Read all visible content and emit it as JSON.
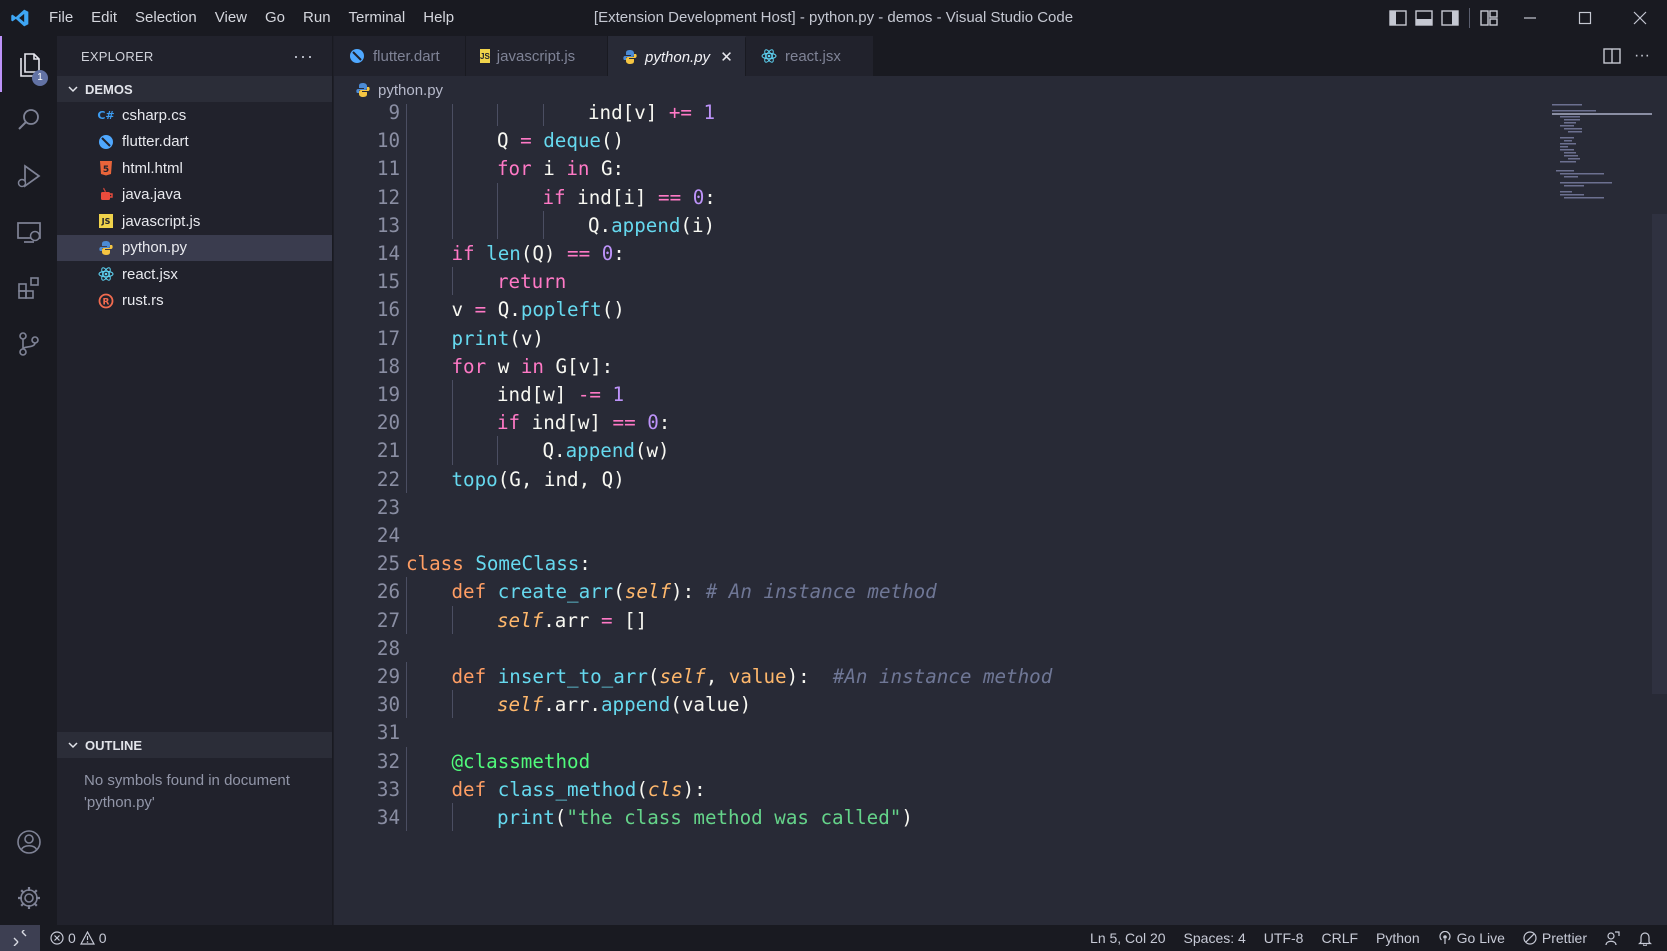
{
  "titlebar": {
    "title": "[Extension Development Host] - python.py - demos - Visual Studio Code",
    "menu": [
      "File",
      "Edit",
      "Selection",
      "View",
      "Go",
      "Run",
      "Terminal",
      "Help"
    ]
  },
  "activity": {
    "explorer_badge": "1"
  },
  "sidebar": {
    "header": "EXPLORER",
    "folder": "DEMOS",
    "files": [
      {
        "name": "csharp.cs",
        "icon": "csharp-icon",
        "glyph": "C#",
        "color": "#3c9bf0"
      },
      {
        "name": "flutter.dart",
        "icon": "dart-icon",
        "glyph": "",
        "color": "#4fa8ff"
      },
      {
        "name": "html.html",
        "icon": "html-icon",
        "glyph": "5",
        "color": "#e8643a"
      },
      {
        "name": "java.java",
        "icon": "java-icon",
        "glyph": "",
        "color": "#ea4b3c"
      },
      {
        "name": "javascript.js",
        "icon": "javascript-icon",
        "glyph": "JS",
        "color": "#f0d34b"
      },
      {
        "name": "python.py",
        "icon": "python-icon",
        "glyph": "",
        "color": "#f5c542"
      },
      {
        "name": "react.jsx",
        "icon": "react-icon",
        "glyph": "",
        "color": "#5ed3f3"
      },
      {
        "name": "rust.rs",
        "icon": "rust-icon",
        "glyph": "R",
        "color": "#f26b4f"
      }
    ],
    "outline_title": "OUTLINE",
    "outline_message": "No symbols found in document 'python.py'"
  },
  "tabs": [
    {
      "label": "flutter.dart",
      "icon": "dart-icon"
    },
    {
      "label": "javascript.js",
      "icon": "javascript-icon"
    },
    {
      "label": "python.py",
      "icon": "python-icon"
    },
    {
      "label": "react.jsx",
      "icon": "react-icon"
    }
  ],
  "breadcrumb": "python.py",
  "statusbar": {
    "errors": "0",
    "warnings": "0",
    "position": "Ln 5, Col 20",
    "spaces": "Spaces: 4",
    "encoding": "UTF-8",
    "eol": "CRLF",
    "language": "Python",
    "golive": "Go Live",
    "prettier": "Prettier"
  },
  "colors": {
    "accent": "#bd93f9",
    "editor_bg": "#282a36",
    "sidebar_bg": "#21222c"
  },
  "code": [
    {
      "ln": "9",
      "indent": 4,
      "tokens": [
        [
          "ind[v] ",
          "var"
        ],
        [
          "+=",
          "pink"
        ],
        [
          " ",
          "var"
        ],
        [
          "1",
          "purple"
        ]
      ]
    },
    {
      "ln": "10",
      "indent": 2,
      "tokens": [
        [
          "Q",
          "var"
        ],
        [
          " = ",
          "pink"
        ],
        [
          "deque",
          "fn"
        ],
        [
          "()",
          "var"
        ]
      ]
    },
    {
      "ln": "11",
      "indent": 2,
      "tokens": [
        [
          "for",
          "pink"
        ],
        [
          " i ",
          "var"
        ],
        [
          "in",
          "pink"
        ],
        [
          " G:",
          "var"
        ]
      ]
    },
    {
      "ln": "12",
      "indent": 3,
      "tokens": [
        [
          "if",
          "pink"
        ],
        [
          " ind[i] ",
          "var"
        ],
        [
          "==",
          "pink"
        ],
        [
          " ",
          "var"
        ],
        [
          "0",
          "purple"
        ],
        [
          ":",
          "var"
        ]
      ]
    },
    {
      "ln": "13",
      "indent": 4,
      "tokens": [
        [
          "Q.",
          "var"
        ],
        [
          "append",
          "fn"
        ],
        [
          "(i)",
          "var"
        ]
      ]
    },
    {
      "ln": "14",
      "indent": 1,
      "tokens": [
        [
          "if",
          "pink"
        ],
        [
          " ",
          "var"
        ],
        [
          "len",
          "fn"
        ],
        [
          "(Q) ",
          "var"
        ],
        [
          "==",
          "pink"
        ],
        [
          " ",
          "var"
        ],
        [
          "0",
          "purple"
        ],
        [
          ":",
          "var"
        ]
      ]
    },
    {
      "ln": "15",
      "indent": 2,
      "tokens": [
        [
          "return",
          "pink"
        ]
      ]
    },
    {
      "ln": "16",
      "indent": 1,
      "tokens": [
        [
          "v",
          "var"
        ],
        [
          " = ",
          "pink"
        ],
        [
          "Q.",
          "var"
        ],
        [
          "popleft",
          "fn"
        ],
        [
          "()",
          "var"
        ]
      ]
    },
    {
      "ln": "17",
      "indent": 1,
      "tokens": [
        [
          "print",
          "fn"
        ],
        [
          "(v)",
          "var"
        ]
      ]
    },
    {
      "ln": "18",
      "indent": 1,
      "tokens": [
        [
          "for",
          "pink"
        ],
        [
          " w ",
          "var"
        ],
        [
          "in",
          "pink"
        ],
        [
          " G[v]:",
          "var"
        ]
      ]
    },
    {
      "ln": "19",
      "indent": 2,
      "tokens": [
        [
          "ind[w] ",
          "var"
        ],
        [
          "-=",
          "pink"
        ],
        [
          " ",
          "var"
        ],
        [
          "1",
          "purple"
        ]
      ]
    },
    {
      "ln": "20",
      "indent": 2,
      "tokens": [
        [
          "if",
          "pink"
        ],
        [
          " ind[w] ",
          "var"
        ],
        [
          "==",
          "pink"
        ],
        [
          " ",
          "var"
        ],
        [
          "0",
          "purple"
        ],
        [
          ":",
          "var"
        ]
      ]
    },
    {
      "ln": "21",
      "indent": 3,
      "tokens": [
        [
          "Q.",
          "var"
        ],
        [
          "append",
          "fn"
        ],
        [
          "(w)",
          "var"
        ]
      ]
    },
    {
      "ln": "22",
      "indent": 1,
      "tokens": [
        [
          "topo",
          "fn"
        ],
        [
          "(G, ind, Q)",
          "var"
        ]
      ]
    },
    {
      "ln": "23",
      "indent": 0,
      "tokens": []
    },
    {
      "ln": "24",
      "indent": 0,
      "tokens": []
    },
    {
      "ln": "25",
      "indent": 0,
      "tokens": [
        [
          "class",
          "def"
        ],
        [
          " ",
          "var"
        ],
        [
          "SomeClass",
          "fn"
        ],
        [
          ":",
          "var"
        ]
      ]
    },
    {
      "ln": "26",
      "indent": 1,
      "tokens": [
        [
          "def",
          "def"
        ],
        [
          " ",
          "var"
        ],
        [
          "create_arr",
          "fn"
        ],
        [
          "(",
          "var"
        ],
        [
          "self",
          "self"
        ],
        [
          "): ",
          "var"
        ],
        [
          "# An instance method",
          "comment"
        ]
      ]
    },
    {
      "ln": "27",
      "indent": 2,
      "tokens": [
        [
          "self",
          "self"
        ],
        [
          ".arr ",
          "var"
        ],
        [
          "=",
          "pink"
        ],
        [
          " []",
          "var"
        ]
      ]
    },
    {
      "ln": "28",
      "indent": 0,
      "tokens": []
    },
    {
      "ln": "29",
      "indent": 1,
      "tokens": [
        [
          "def",
          "def"
        ],
        [
          " ",
          "var"
        ],
        [
          "insert_to_arr",
          "fn"
        ],
        [
          "(",
          "var"
        ],
        [
          "self",
          "self"
        ],
        [
          ", ",
          "var"
        ],
        [
          "value",
          "orange"
        ],
        [
          "):  ",
          "var"
        ],
        [
          "#An instance method",
          "comment"
        ]
      ]
    },
    {
      "ln": "30",
      "indent": 2,
      "tokens": [
        [
          "self",
          "self"
        ],
        [
          ".arr.",
          "var"
        ],
        [
          "append",
          "fn"
        ],
        [
          "(value)",
          "var"
        ]
      ]
    },
    {
      "ln": "31",
      "indent": 0,
      "tokens": []
    },
    {
      "ln": "32",
      "indent": 1,
      "tokens": [
        [
          "@classmethod",
          "green"
        ]
      ]
    },
    {
      "ln": "33",
      "indent": 1,
      "tokens": [
        [
          "def",
          "def"
        ],
        [
          " ",
          "var"
        ],
        [
          "class_method",
          "fn"
        ],
        [
          "(",
          "var"
        ],
        [
          "cls",
          "self"
        ],
        [
          "):",
          "var"
        ]
      ]
    },
    {
      "ln": "34",
      "indent": 2,
      "tokens": [
        [
          "print",
          "fn"
        ],
        [
          "(",
          "var"
        ],
        [
          "\"the class method was called\"",
          "str"
        ],
        [
          ")",
          "var"
        ]
      ]
    }
  ]
}
